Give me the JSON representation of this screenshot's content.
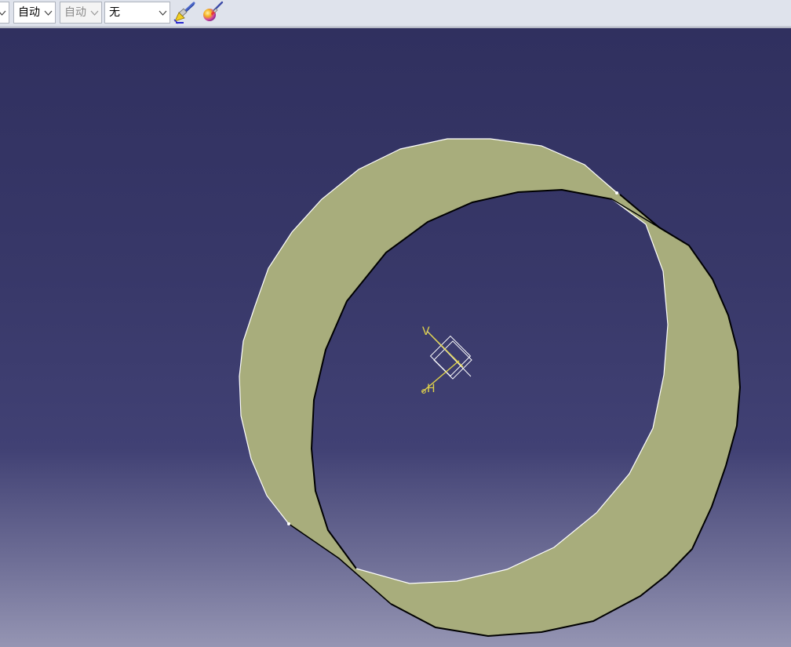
{
  "toolbar": {
    "combo_left_partial": {
      "value": ""
    },
    "combo_auto_1": {
      "value": "自动"
    },
    "combo_auto_2": {
      "value": "自动",
      "disabled": true
    },
    "combo_none": {
      "value": "无"
    },
    "paint_icon": "paint-brush-icon",
    "material_icon": "apply-material-icon"
  },
  "viewport": {
    "background_top": "#30305f",
    "background_bottom": "#9595b3",
    "ring_color": "#a8ad7c",
    "edge_color": "#000000",
    "axis_color": "#e1d34a",
    "compass": {
      "v_label": "V",
      "h_label": "H"
    }
  }
}
